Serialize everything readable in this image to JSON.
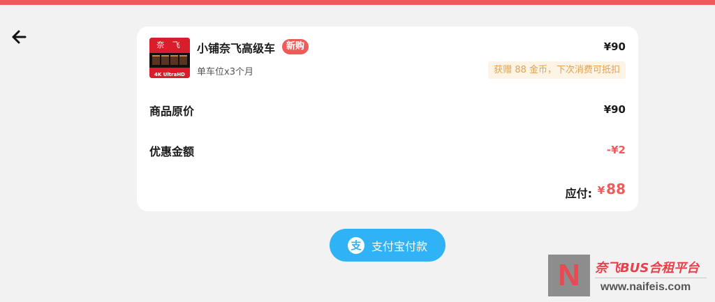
{
  "header": {
    "accent_color": "#f25a5a",
    "back_icon": "arrow-left-icon"
  },
  "order": {
    "product": {
      "thumbnail_title": "奈 飞",
      "thumbnail_label": "4K UltraHD",
      "name": "小铺奈飞高级车",
      "badge": "新购",
      "price": "¥90",
      "spec": "单车位x3个月",
      "reward": "获赠 88 金币，下次消费可抵扣"
    },
    "original_price": {
      "label": "商品原价",
      "value": "¥90"
    },
    "discount": {
      "label": "优惠金额",
      "value": "-¥2"
    },
    "total": {
      "label": "应付:",
      "currency": "¥",
      "amount": "88"
    }
  },
  "payment": {
    "icon": "alipay-icon",
    "icon_glyph": "支",
    "button_label": "支付宝付款",
    "button_color": "#2fb2f6"
  },
  "watermark": {
    "logo_letter": "N",
    "brand": "奈飞BUS合租平台",
    "url": "www.naifeis.com"
  }
}
